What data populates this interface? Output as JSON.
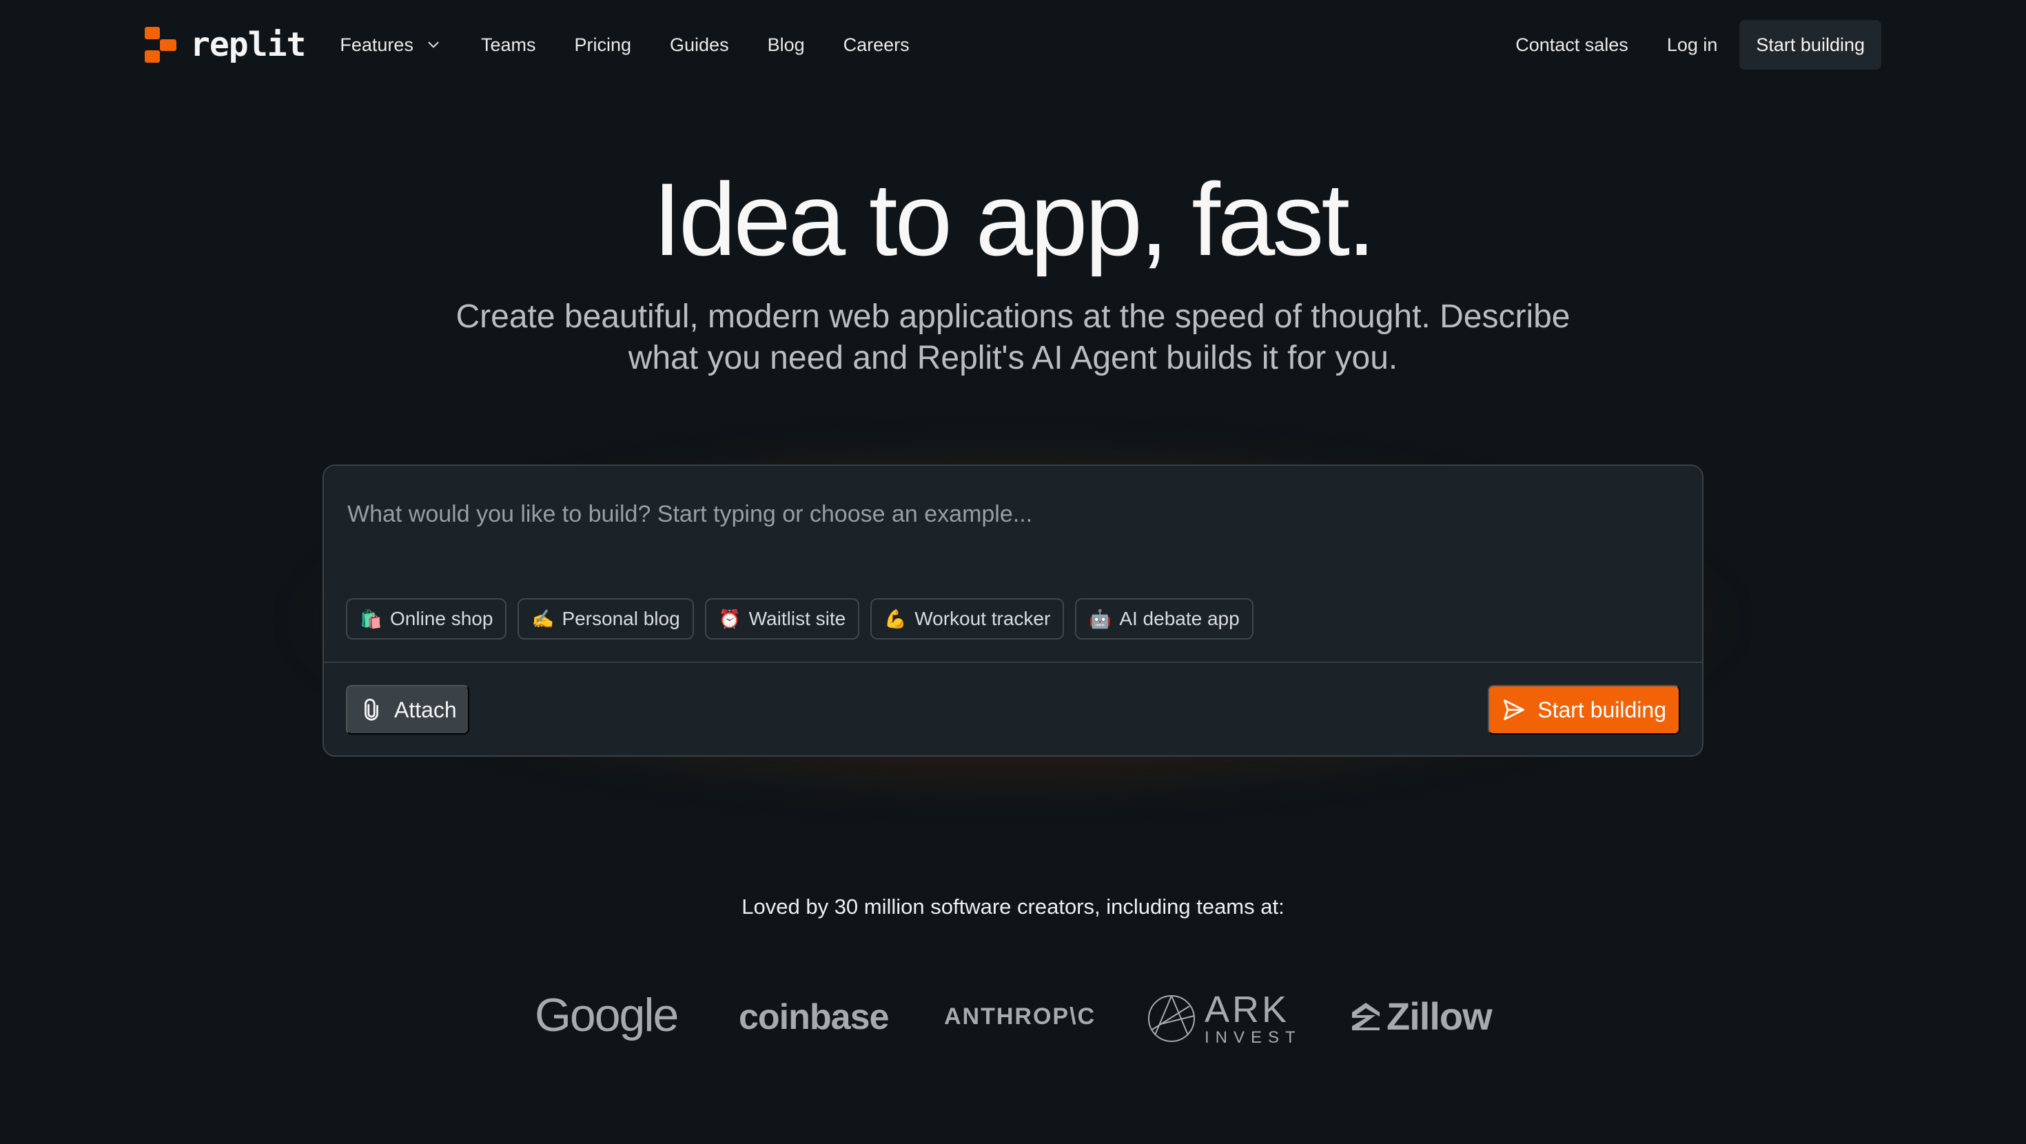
{
  "nav": {
    "logo_text": "replit",
    "links": [
      {
        "label": "Features"
      },
      {
        "label": "Teams"
      },
      {
        "label": "Pricing"
      },
      {
        "label": "Guides"
      },
      {
        "label": "Blog"
      },
      {
        "label": "Careers"
      }
    ],
    "contact_sales": "Contact sales",
    "login": "Log in",
    "start_building": "Start building"
  },
  "hero": {
    "title": "Idea to app, fast.",
    "subtitle_line1": "Create beautiful, modern web applications at the speed of thought. Describe",
    "subtitle_line2": "what you need and Replit's AI Agent builds it for you."
  },
  "prompt": {
    "placeholder": "What would you like to build? Start typing or choose an example...",
    "value": "",
    "examples": [
      {
        "emoji": "🛍️",
        "label": "Online shop"
      },
      {
        "emoji": "✍️",
        "label": "Personal blog"
      },
      {
        "emoji": "⏰",
        "label": "Waitlist site"
      },
      {
        "emoji": "💪",
        "label": "Workout tracker"
      },
      {
        "emoji": "🤖",
        "label": "AI debate app"
      }
    ],
    "attach_label": "Attach",
    "submit_label": "Start building"
  },
  "social_proof": {
    "headline": "Loved by 30 million software creators, including teams at:",
    "logos": {
      "google": "Google",
      "coinbase": "coinbase",
      "anthropic": "ANTHROP\\C",
      "ark_main": "ARK",
      "ark_sub": "INVEST",
      "zillow": "Zillow"
    }
  },
  "colors": {
    "background": "#0e1418",
    "accent": "#f26207",
    "panel": "#1b2329",
    "muted_text": "#b9bec3",
    "logo_gray": "#a6abb0"
  },
  "icons": {
    "features_chevron": "chevron-down-icon",
    "attach": "paperclip-icon",
    "submit": "send-icon"
  }
}
